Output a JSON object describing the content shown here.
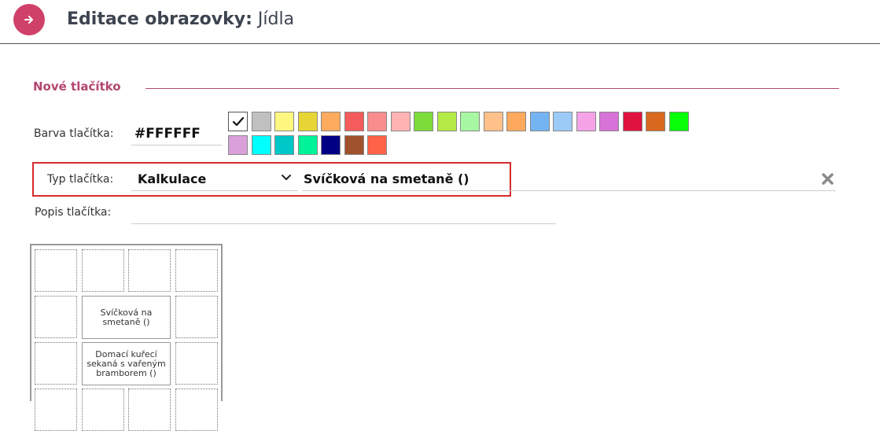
{
  "header": {
    "title_bold": "Editace obrazovky:",
    "title_rest": "Jídla"
  },
  "section": {
    "title": "Nové tlačítko"
  },
  "form": {
    "color_label": "Barva tlačítka:",
    "color_value": "#FFFFFF",
    "type_label": "Typ tlačítka:",
    "type_value": "Kalkulace",
    "item_value": "Svíčková na smetaně ()",
    "desc_label": "Popis tlačítka:",
    "desc_value": ""
  },
  "swatches": [
    [
      "#ffffff",
      "#c0c0c0",
      "#fef880",
      "#e6d534",
      "#ffab5e",
      "#f45b5b",
      "#f98d8d",
      "#ffb3b3",
      "#7ddc3a",
      "#b3ea45",
      "#a8f7a2",
      "#ffc08a",
      "#ffa95c",
      "#74b4f2",
      "#9ccbf7",
      "#f5a3e6",
      "#d772d8",
      "#e01240",
      "#d9691e",
      "#07ff07"
    ],
    [
      "#d9a0d9",
      "#00ffff",
      "#00c8c8",
      "#00f497",
      "#010085",
      "#a0522d",
      "#ff6347"
    ]
  ],
  "grid": {
    "cell_1_label": "Svíčková na smetaně ()",
    "cell_2_label": "Domací kuřecí sekaná s vařeným bramborem ()"
  }
}
